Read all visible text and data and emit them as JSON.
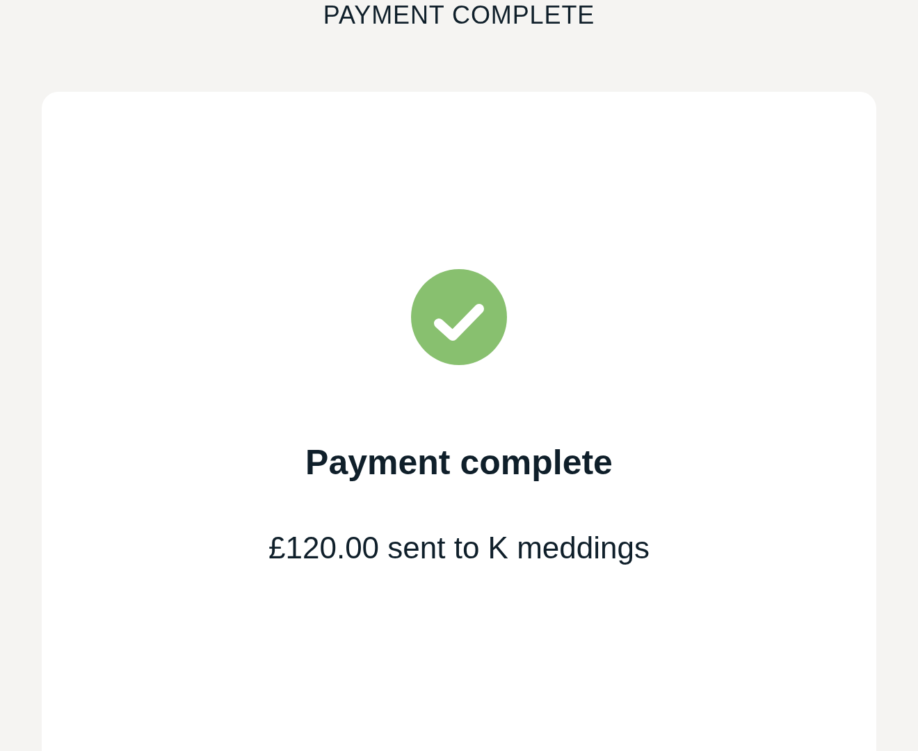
{
  "header": {
    "title": "PAYMENT COMPLETE"
  },
  "confirmation": {
    "heading": "Payment complete",
    "message": "£120.00 sent to K meddings"
  }
}
